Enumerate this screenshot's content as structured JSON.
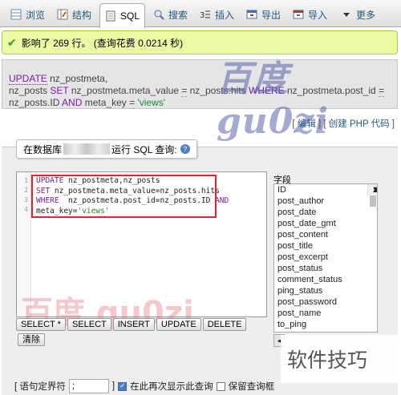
{
  "tabs": [
    {
      "label": "浏览",
      "icon": "browse-icon"
    },
    {
      "label": "结构",
      "icon": "structure-icon"
    },
    {
      "label": "SQL",
      "icon": "sql-icon",
      "active": true
    },
    {
      "label": "搜索",
      "icon": "search-icon"
    },
    {
      "label": "插入",
      "icon": "insert-icon"
    },
    {
      "label": "导出",
      "icon": "export-icon"
    },
    {
      "label": "导入",
      "icon": "import-icon"
    },
    {
      "label": "更多",
      "icon": "chevron-down-icon"
    }
  ],
  "message": {
    "text": "影响了 269 行。 (查询花费 0.0214 秒)",
    "status_color": "#ebf8a4"
  },
  "executed_sql": {
    "kw_update": "UPDATE",
    "line1_rest": " nz_postmeta,",
    "line2_start": "nz_posts ",
    "kw_set": "SET",
    "set_field": " nz_postmeta.meta_value ",
    "eq": "=",
    "set_value": " nz_posts.hits ",
    "kw_where": "WHERE",
    "where_field": " nz_postmeta.post_id ",
    "line3_start": "nz_posts.ID ",
    "kw_and": "AND",
    "meta_key": " meta_key ",
    "eq2": "=",
    "views_literal": " 'views'"
  },
  "edit_links": {
    "edit": "编辑",
    "create_php": "创建 PHP 代码"
  },
  "query_panel": {
    "legend_prefix": "在数据库",
    "legend_suffix": "运行 SQL 查询:",
    "help_icon": "help-icon"
  },
  "editor": {
    "line_numbers": [
      "1",
      "2",
      "3",
      "4"
    ],
    "lines": [
      "UPDATE nz_postmeta,nz_posts",
      "SET nz_postmeta.meta_value=nz_posts.hits",
      "WHERE  nz_postmeta.post_id=nz_posts.ID AND",
      "meta_key='views'"
    ]
  },
  "buttons": {
    "select_star": "SELECT *",
    "select": "SELECT",
    "insert": "INSERT",
    "update": "UPDATE",
    "delete": "DELETE",
    "clear": "清除"
  },
  "fields": {
    "label": "字段",
    "items": [
      "ID",
      "post_author",
      "post_date",
      "post_date_gmt",
      "post_content",
      "post_title",
      "post_excerpt",
      "post_status",
      "comment_status",
      "ping_status",
      "post_password",
      "post_name",
      "to_ping"
    ],
    "insert_arrow": "<<"
  },
  "bottom_bar": {
    "delimiter_label": "[ 语句定界符",
    "delimiter_value": ";",
    "bracket": "]",
    "show_again": "在此再次显示此查询",
    "retain_box": "保留查询框"
  },
  "watermarks": {
    "top_right": "百度 gu0zi",
    "editor_overlay": "百度 gu0zi",
    "bottom_right": "软件技巧"
  },
  "colors": {
    "keyword": "#7a1fa2",
    "string": "#1b8a35",
    "link": "#235a81",
    "highlight_border": "#e0262b"
  }
}
